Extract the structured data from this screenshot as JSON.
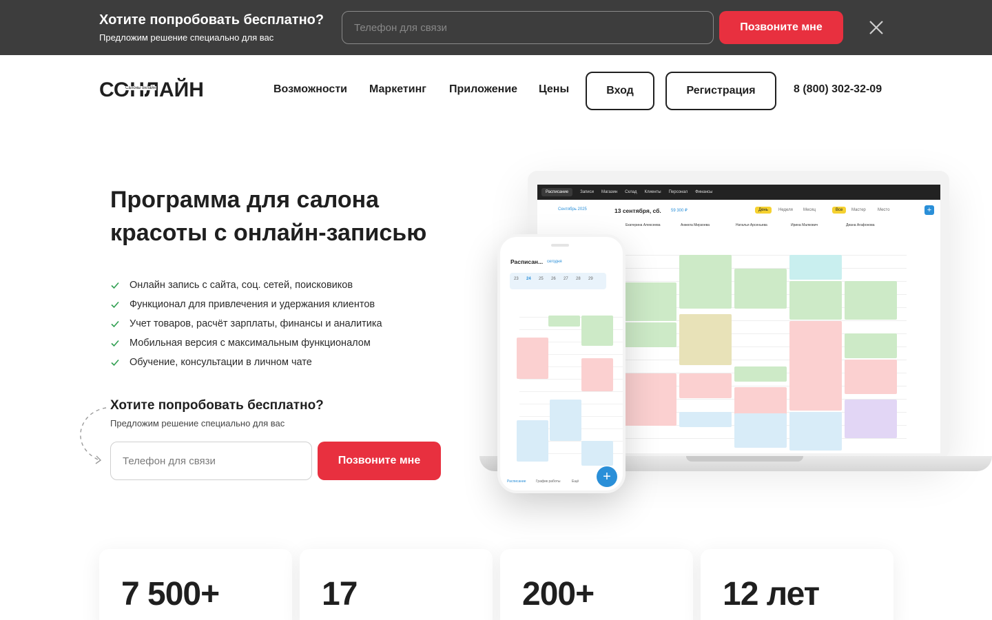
{
  "promo_bar": {
    "title": "Хотите попробовать бесплатно?",
    "subtitle": "Предложим решение специально для вас",
    "phone_placeholder": "Телефон для связи",
    "call_button": "Позвоните мне",
    "close_icon": "close-icon"
  },
  "header": {
    "logo_text": "СОНЛАЙН",
    "logo_small": "Салоны онлайн",
    "nav": [
      "Возможности",
      "Маркетинг",
      "Приложение",
      "Цены"
    ],
    "login": "Вход",
    "register": "Регистрация",
    "phone": "8 (800) 302-32-09"
  },
  "hero": {
    "title": "Программа для салона красоты с онлайн-записью",
    "features": [
      "Онлайн запись с сайта, соц. сетей, поисковиков",
      "Функционал для привлечения и удержания клиентов",
      "Учет товаров, расчёт зарплаты, финансы и аналитика",
      "Мобильная версия с максимальным функционалом",
      "Обучение, консультации в личном чате"
    ],
    "try_title": "Хотите попробовать бесплатно?",
    "try_subtitle": "Предложим решение специально для вас",
    "phone_placeholder": "Телефон для связи",
    "call_button": "Позвоните мне",
    "check_icon": "check-icon",
    "accent_color": "#e8303f",
    "check_color": "#2e9e4f"
  },
  "laptop_app": {
    "tabs": [
      "Расписание",
      "Записи",
      "Магазин",
      "Склад",
      "Клиенты",
      "Персонал",
      "Финансы"
    ],
    "date": "13 сентября, сб.",
    "month": "Сентябрь 2025",
    "amount": "59 300 ₽",
    "views": [
      "День",
      "Неделя",
      "Месяц"
    ],
    "filters": [
      "Все",
      "Мастер",
      "Место"
    ],
    "staff": [
      "Екатерина Алексеева",
      "Анжела Мирзоева",
      "Наталья Арсеньева",
      "Ирина Малкович",
      "Диана Агафонова"
    ]
  },
  "phone_app": {
    "title": "Расписан...",
    "today": "сегодня",
    "days": [
      "23",
      "24",
      "25",
      "26",
      "27",
      "28",
      "29"
    ],
    "bottom_nav": [
      "Расписание",
      "График работы",
      "Ещё"
    ]
  },
  "stats": [
    "7 500+",
    "17",
    "200+",
    "12 лет"
  ]
}
